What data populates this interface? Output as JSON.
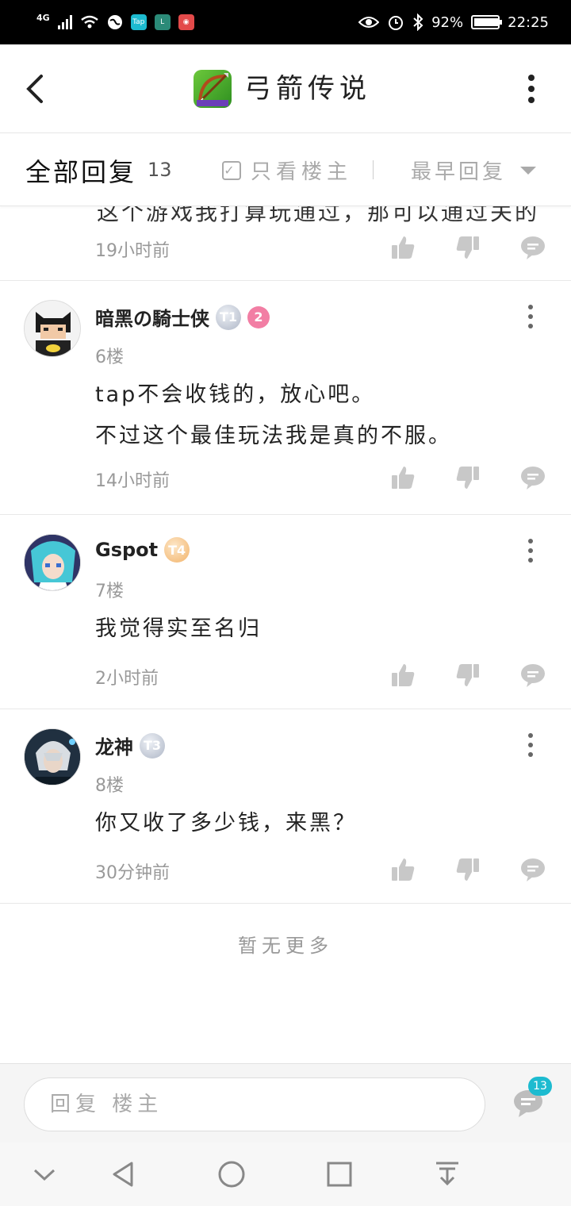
{
  "status_bar": {
    "network": "4G",
    "battery": "92%",
    "time": "22:25",
    "app_icons": [
      "tap",
      "L",
      "stamp"
    ]
  },
  "header": {
    "title": "弓箭传说",
    "game_icon": "bow-arrow-icon"
  },
  "filter": {
    "all_label": "全部回复",
    "count": "13",
    "only_owner_label": "只看楼主",
    "sort_label": "最早回复"
  },
  "partial": {
    "text": "这个游戏我打算玩通过，那可以通过关的",
    "time": "19小时前"
  },
  "comments": [
    {
      "username": "暗黑の騎士侠",
      "badge": "T1",
      "extra_badge": "2",
      "floor": "6楼",
      "lines": [
        "tap不会收钱的，放心吧。",
        "不过这个最佳玩法我是真的不服。"
      ],
      "time": "14小时前"
    },
    {
      "username": "Gspot",
      "badge": "T4",
      "floor": "7楼",
      "lines": [
        "我觉得实至名归"
      ],
      "time": "2小时前"
    },
    {
      "username": "龙神",
      "badge": "T3",
      "floor": "8楼",
      "lines": [
        "你又收了多少钱，来黑？"
      ],
      "time": "30分钟前"
    }
  ],
  "no_more": "暂无更多",
  "reply": {
    "placeholder": "回复 楼主",
    "comment_count": "13"
  },
  "colors": {
    "accent": "#1dbbd0",
    "muted": "#999999",
    "divider": "#e8e8e8"
  }
}
